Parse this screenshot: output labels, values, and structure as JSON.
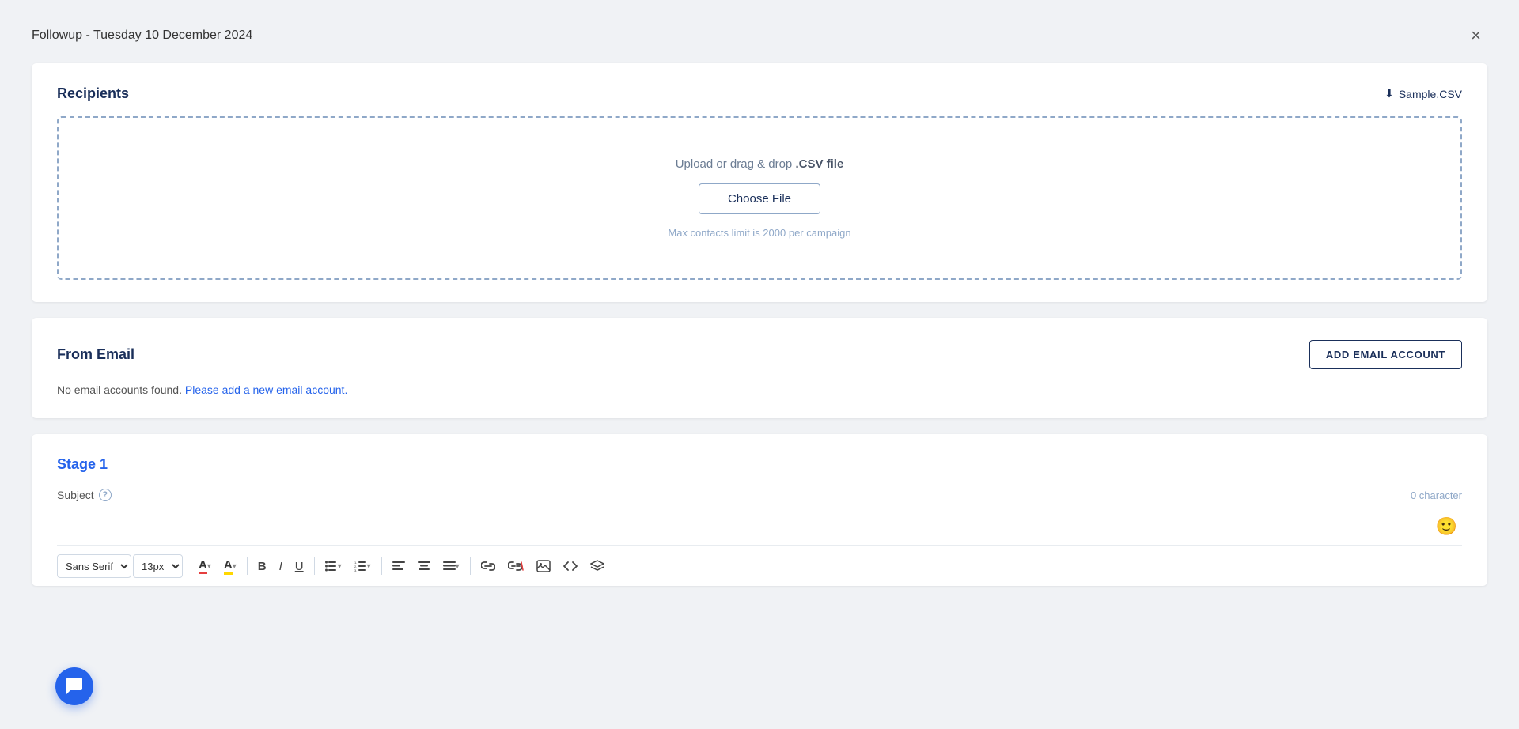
{
  "header": {
    "title": "Followup - Tuesday 10 December 2024",
    "close_label": "×"
  },
  "recipients_card": {
    "title": "Recipients",
    "sample_csv_label": "Sample.CSV",
    "drop_zone": {
      "upload_text_prefix": "Upload or drag & drop ",
      "upload_text_highlight": ".CSV file",
      "choose_file_label": "Choose File",
      "limit_text": "Max contacts limit is 2000 per campaign"
    }
  },
  "from_email_card": {
    "title": "From Email",
    "no_accounts_text": "No email accounts found.",
    "add_account_link_text": "Please add a new email account.",
    "add_email_account_label": "ADD EMAIL ACCOUNT"
  },
  "stage1_card": {
    "title": "Stage 1",
    "subject_label": "Subject",
    "char_count": "0 character",
    "help_icon": "?"
  },
  "toolbar": {
    "font_family": "Sans Serif",
    "font_size": "13px",
    "font_family_arrow": "▾",
    "font_size_arrow": "▾",
    "text_color_label": "A",
    "bg_color_label": "A",
    "bold_label": "B",
    "italic_label": "I",
    "underline_label": "U",
    "bullet_list_label": "≡",
    "ordered_list_label": "≡",
    "align_left_label": "≡",
    "align_center_label": "≡",
    "align_dropdown_label": "▾"
  },
  "chat_button": {
    "icon": "💬"
  }
}
